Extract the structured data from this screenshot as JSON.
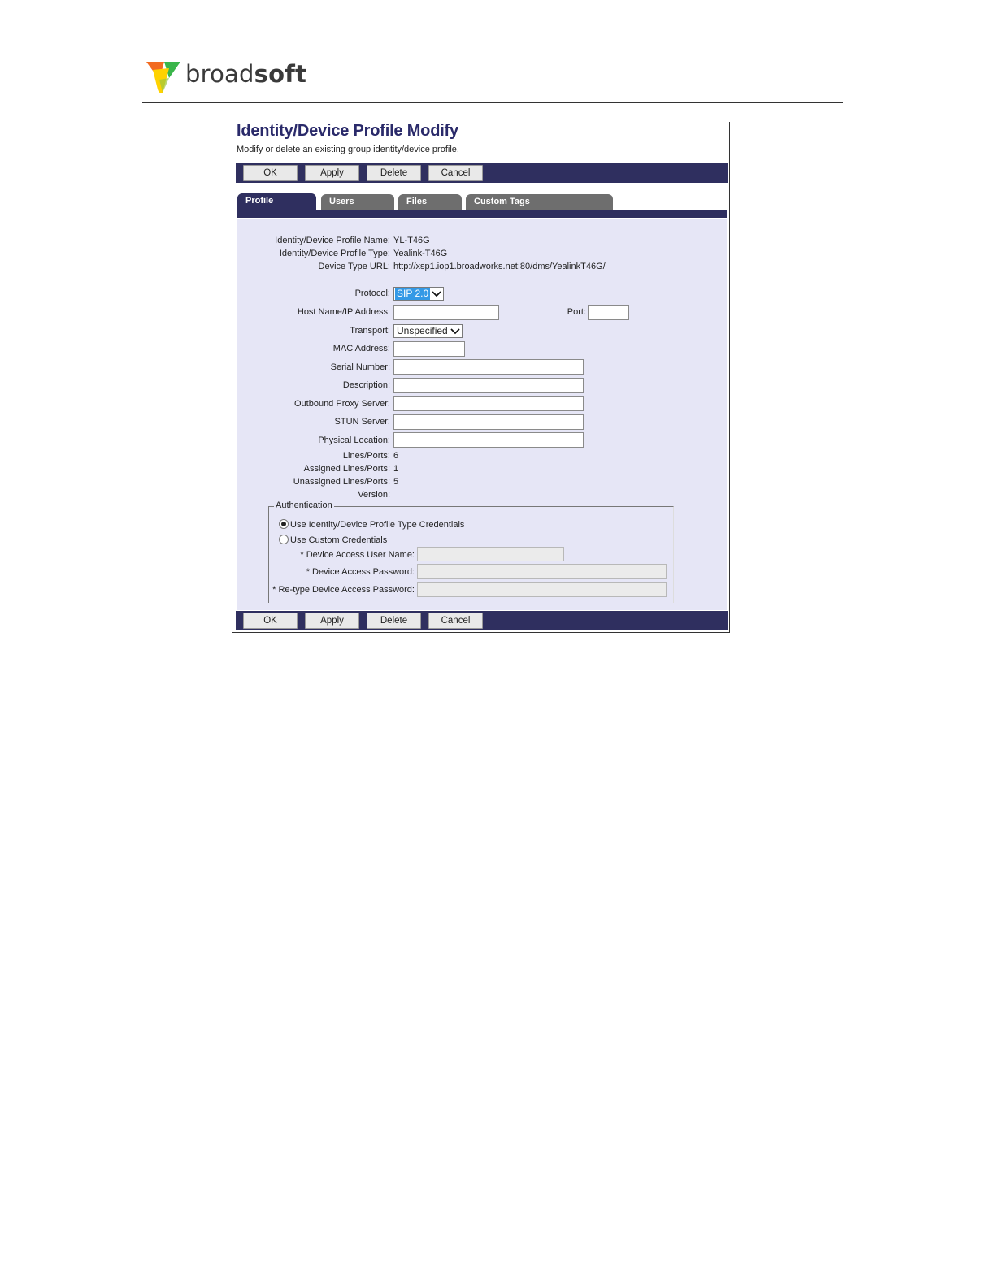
{
  "brand": {
    "logo_text_regular": "broad",
    "logo_text_bold": "soft"
  },
  "page": {
    "title": "Identity/Device Profile Modify",
    "subtitle": "Modify or delete an existing group identity/device profile."
  },
  "actions": {
    "ok": "OK",
    "apply": "Apply",
    "delete": "Delete",
    "cancel": "Cancel"
  },
  "tabs": [
    {
      "label": "Profile",
      "active": true
    },
    {
      "label": "Users",
      "active": false
    },
    {
      "label": "Files",
      "active": false
    },
    {
      "label": "Custom Tags",
      "active": false
    }
  ],
  "profile": {
    "name_label": "Identity/Device Profile Name:",
    "name_value": "YL-T46G",
    "type_label": "Identity/Device Profile Type:",
    "type_value": "Yealink-T46G",
    "url_label": "Device Type URL:",
    "url_value": "http://xsp1.iop1.broadworks.net:80/dms/YealinkT46G/"
  },
  "form": {
    "protocol_label": "Protocol:",
    "protocol_value": "SIP 2.0",
    "host_label": "Host Name/IP Address:",
    "host_value": "",
    "port_label": "Port:",
    "port_value": "",
    "transport_label": "Transport:",
    "transport_value": "Unspecified",
    "mac_label": "MAC Address:",
    "mac_value": "",
    "serial_label": "Serial Number:",
    "serial_value": "",
    "description_label": "Description:",
    "description_value": "",
    "outbound_label": "Outbound Proxy Server:",
    "outbound_value": "",
    "stun_label": "STUN Server:",
    "stun_value": "",
    "location_label": "Physical Location:",
    "location_value": ""
  },
  "lines": {
    "lines_label": "Lines/Ports:",
    "lines_value": "6",
    "assigned_label": "Assigned Lines/Ports:",
    "assigned_value": "1",
    "unassigned_label": "Unassigned Lines/Ports:",
    "unassigned_value": "5",
    "version_label": "Version:",
    "version_value": ""
  },
  "auth": {
    "legend": "Authentication",
    "option_type": "Use Identity/Device Profile Type Credentials",
    "option_custom": "Use Custom Credentials",
    "selected": "type",
    "username_label": "* Device Access User Name:",
    "password_label": "* Device Access Password:",
    "retype_label": "* Re-type Device Access Password:"
  },
  "colors": {
    "accent": "#2f2f5f",
    "panel": "#e6e6f6",
    "tab_inactive": "#6e6e6e"
  }
}
